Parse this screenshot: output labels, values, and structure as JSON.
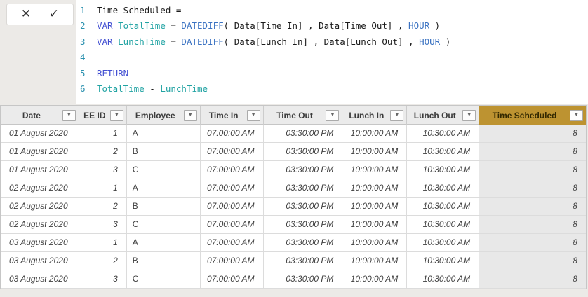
{
  "formula_bar": {
    "icons": {
      "cancel": "✕",
      "accept": "✓"
    }
  },
  "editor": {
    "lines": [
      {
        "num": "1",
        "segments": [
          {
            "t": "Time Scheduled =",
            "c": "plain"
          }
        ]
      },
      {
        "num": "2",
        "segments": [
          {
            "t": "VAR",
            "c": "keyword"
          },
          {
            "t": " ",
            "c": "plain"
          },
          {
            "t": "TotalTime",
            "c": "variable"
          },
          {
            "t": " = ",
            "c": "plain"
          },
          {
            "t": "DATEDIFF",
            "c": "function"
          },
          {
            "t": "( Data[Time In] , Data[Time Out] , ",
            "c": "plain"
          },
          {
            "t": "HOUR",
            "c": "function"
          },
          {
            "t": " )",
            "c": "plain"
          }
        ]
      },
      {
        "num": "3",
        "segments": [
          {
            "t": "VAR",
            "c": "keyword"
          },
          {
            "t": " ",
            "c": "plain"
          },
          {
            "t": "LunchTime",
            "c": "variable"
          },
          {
            "t": " = ",
            "c": "plain"
          },
          {
            "t": "DATEDIFF",
            "c": "function"
          },
          {
            "t": "( Data[Lunch In] , Data[Lunch Out] , ",
            "c": "plain"
          },
          {
            "t": "HOUR",
            "c": "function"
          },
          {
            "t": " )",
            "c": "plain"
          }
        ]
      },
      {
        "num": "4",
        "segments": []
      },
      {
        "num": "5",
        "segments": [
          {
            "t": "RETURN",
            "c": "keyword"
          }
        ]
      },
      {
        "num": "6",
        "segments": [
          {
            "t": "TotalTime",
            "c": "variable"
          },
          {
            "t": " - ",
            "c": "plain"
          },
          {
            "t": "LunchTime",
            "c": "variable"
          }
        ]
      }
    ]
  },
  "table": {
    "filter_icon": "▼",
    "columns": [
      {
        "label": "Date",
        "highlight": false
      },
      {
        "label": "EE ID",
        "highlight": false
      },
      {
        "label": "Employee",
        "highlight": false
      },
      {
        "label": "Time In",
        "highlight": false
      },
      {
        "label": "Time Out",
        "highlight": false
      },
      {
        "label": "Lunch In",
        "highlight": false
      },
      {
        "label": "Lunch Out",
        "highlight": false
      },
      {
        "label": "Time Scheduled",
        "highlight": true
      }
    ],
    "rows": [
      [
        "01 August 2020",
        "1",
        "A",
        "07:00:00 AM",
        "03:30:00 PM",
        "10:00:00 AM",
        "10:30:00 AM",
        "8"
      ],
      [
        "01 August 2020",
        "2",
        "B",
        "07:00:00 AM",
        "03:30:00 PM",
        "10:00:00 AM",
        "10:30:00 AM",
        "8"
      ],
      [
        "01 August 2020",
        "3",
        "C",
        "07:00:00 AM",
        "03:30:00 PM",
        "10:00:00 AM",
        "10:30:00 AM",
        "8"
      ],
      [
        "02 August 2020",
        "1",
        "A",
        "07:00:00 AM",
        "03:30:00 PM",
        "10:00:00 AM",
        "10:30:00 AM",
        "8"
      ],
      [
        "02 August 2020",
        "2",
        "B",
        "07:00:00 AM",
        "03:30:00 PM",
        "10:00:00 AM",
        "10:30:00 AM",
        "8"
      ],
      [
        "02 August 2020",
        "3",
        "C",
        "07:00:00 AM",
        "03:30:00 PM",
        "10:00:00 AM",
        "10:30:00 AM",
        "8"
      ],
      [
        "03 August 2020",
        "1",
        "A",
        "07:00:00 AM",
        "03:30:00 PM",
        "10:00:00 AM",
        "10:30:00 AM",
        "8"
      ],
      [
        "03 August 2020",
        "2",
        "B",
        "07:00:00 AM",
        "03:30:00 PM",
        "10:00:00 AM",
        "10:30:00 AM",
        "8"
      ],
      [
        "03 August 2020",
        "3",
        "C",
        "07:00:00 AM",
        "03:30:00 PM",
        "10:00:00 AM",
        "10:30:00 AM",
        "8"
      ]
    ]
  },
  "colors": {
    "keyword": "#4350D2",
    "function": "#3A72C2",
    "variable": "#21A3A3",
    "line_number": "#2B91AF",
    "highlight_header_bg": "#BD9331"
  }
}
